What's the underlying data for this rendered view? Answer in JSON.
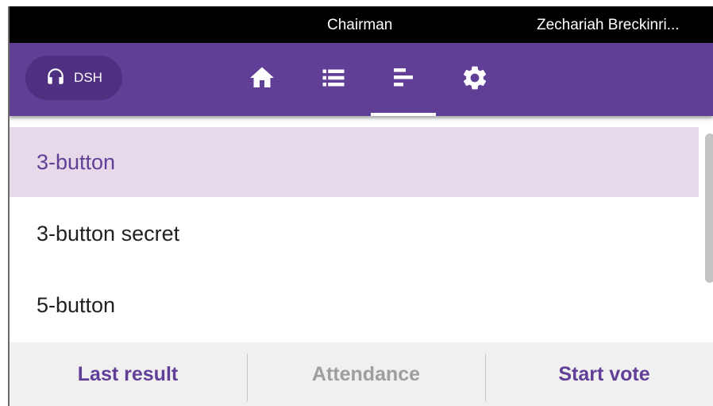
{
  "header": {
    "role": "Chairman",
    "username": "Zechariah Breckinri..."
  },
  "nav": {
    "chip_label": "DSH",
    "chip_icon": "headset-icon",
    "icons": [
      "home-icon",
      "list-icon",
      "sort-bars-icon",
      "gear-icon"
    ],
    "active_tab": "sort-bars-icon"
  },
  "list": {
    "items": [
      {
        "label": "3-button",
        "selected": true
      },
      {
        "label": "3-button secret",
        "selected": false
      },
      {
        "label": "5-button",
        "selected": false
      }
    ]
  },
  "actions": {
    "last_result": "Last result",
    "attendance": "Attendance",
    "start_vote": "Start vote"
  },
  "colors": {
    "primary": "#623f97",
    "chip_bg": "#4e2f80",
    "selected_bg": "#e5d9ea",
    "disabled_text": "#9e9e9e",
    "topbar": "#000000"
  }
}
